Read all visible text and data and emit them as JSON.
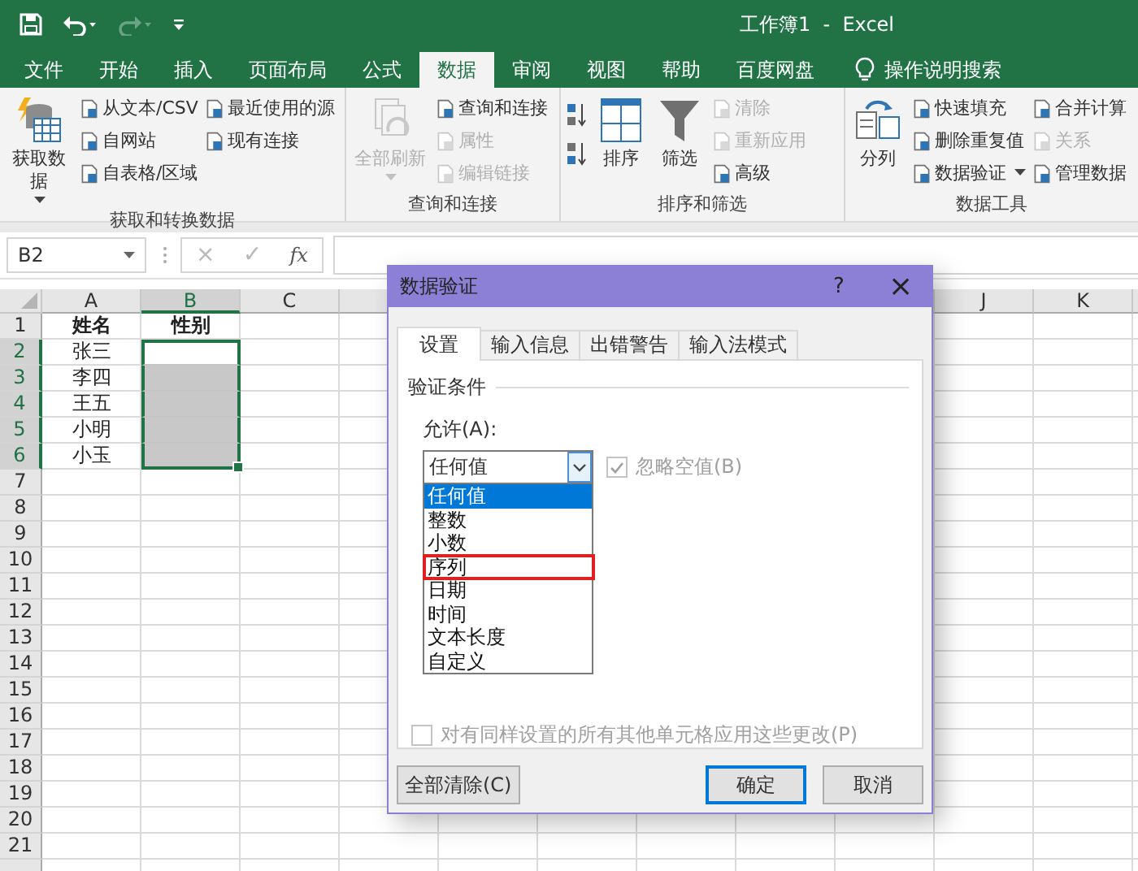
{
  "window": {
    "title": "工作簿1  -  Excel"
  },
  "tabs": [
    {
      "label": "文件",
      "selected": false
    },
    {
      "label": "开始",
      "selected": false
    },
    {
      "label": "插入",
      "selected": false
    },
    {
      "label": "页面布局",
      "selected": false
    },
    {
      "label": "公式",
      "selected": false
    },
    {
      "label": "数据",
      "selected": true
    },
    {
      "label": "审阅",
      "selected": false
    },
    {
      "label": "视图",
      "selected": false
    },
    {
      "label": "帮助",
      "selected": false
    },
    {
      "label": "百度网盘",
      "selected": false
    }
  ],
  "tell_me": "操作说明搜索",
  "ribbon": [
    {
      "label": "获取和转换数据",
      "columns": [
        {
          "kind": "large",
          "label": "获取数据",
          "dropdown": true,
          "disabled": false
        },
        {
          "kind": "stack",
          "items": [
            {
              "label": "从文本/CSV",
              "disabled": false,
              "dropdown": false
            },
            {
              "label": "自网站",
              "disabled": false,
              "dropdown": false
            },
            {
              "label": "自表格/区域",
              "disabled": false,
              "dropdown": false
            }
          ]
        },
        {
          "kind": "stack",
          "items": [
            {
              "label": "最近使用的源",
              "disabled": false,
              "dropdown": false
            },
            {
              "label": "现有连接",
              "disabled": false,
              "dropdown": false
            }
          ]
        }
      ]
    },
    {
      "label": "查询和连接",
      "columns": [
        {
          "kind": "large",
          "label": "全部刷新",
          "dropdown": true,
          "disabled": true
        },
        {
          "kind": "stack",
          "items": [
            {
              "label": "查询和连接",
              "disabled": false,
              "dropdown": false
            },
            {
              "label": "属性",
              "disabled": true,
              "dropdown": false
            },
            {
              "label": "编辑链接",
              "disabled": true,
              "dropdown": false
            }
          ]
        }
      ]
    },
    {
      "label": "排序和筛选",
      "columns": [
        {
          "kind": "sort_icons"
        },
        {
          "kind": "large",
          "label": "排序",
          "dropdown": false,
          "disabled": false
        },
        {
          "kind": "large",
          "label": "筛选",
          "dropdown": false,
          "disabled": false
        },
        {
          "kind": "stack",
          "items": [
            {
              "label": "清除",
              "disabled": true,
              "dropdown": false
            },
            {
              "label": "重新应用",
              "disabled": true,
              "dropdown": false
            },
            {
              "label": "高级",
              "disabled": false,
              "dropdown": false
            }
          ]
        }
      ]
    },
    {
      "label": "数据工具",
      "columns": [
        {
          "kind": "large",
          "label": "分列",
          "dropdown": false,
          "disabled": false
        },
        {
          "kind": "stack",
          "items": [
            {
              "label": "快速填充",
              "disabled": false,
              "dropdown": false
            },
            {
              "label": "删除重复值",
              "disabled": false,
              "dropdown": false
            },
            {
              "label": "数据验证",
              "disabled": false,
              "dropdown": true
            }
          ]
        },
        {
          "kind": "stack",
          "items": [
            {
              "label": "合并计算",
              "disabled": false,
              "dropdown": false
            },
            {
              "label": "关系",
              "disabled": true,
              "dropdown": false
            },
            {
              "label": "管理数据",
              "disabled": false,
              "dropdown": false
            }
          ]
        }
      ]
    }
  ],
  "formula_bar": {
    "name_box": "B2",
    "cancel": "×",
    "enter": "✓",
    "function": "fx"
  },
  "columns": [
    {
      "label": "A",
      "selected": false
    },
    {
      "label": "B",
      "selected": true
    },
    {
      "label": "C",
      "selected": false
    },
    {
      "label": "J",
      "selected": false
    },
    {
      "label": "K",
      "selected": false
    }
  ],
  "rows": [
    {
      "number": "1",
      "selected": false,
      "cells": [
        {
          "text": "姓名",
          "bold": true
        },
        {
          "text": "性别",
          "bold": true
        }
      ]
    },
    {
      "number": "2",
      "selected": true,
      "cells": [
        {
          "text": "张三",
          "bold": false
        }
      ]
    },
    {
      "number": "3",
      "selected": true,
      "cells": [
        {
          "text": "李四",
          "bold": false
        }
      ]
    },
    {
      "number": "4",
      "selected": true,
      "cells": [
        {
          "text": "王五",
          "bold": false
        }
      ]
    },
    {
      "number": "5",
      "selected": true,
      "cells": [
        {
          "text": "小明",
          "bold": false
        }
      ]
    },
    {
      "number": "6",
      "selected": true,
      "cells": [
        {
          "text": "小玉",
          "bold": false
        }
      ]
    },
    {
      "number": "7",
      "selected": false
    },
    {
      "number": "8",
      "selected": false
    },
    {
      "number": "9",
      "selected": false
    },
    {
      "number": "10",
      "selected": false
    },
    {
      "number": "11",
      "selected": false
    },
    {
      "number": "12",
      "selected": false
    },
    {
      "number": "13",
      "selected": false
    },
    {
      "number": "14",
      "selected": false
    },
    {
      "number": "15",
      "selected": false
    },
    {
      "number": "16",
      "selected": false
    },
    {
      "number": "17",
      "selected": false
    },
    {
      "number": "18",
      "selected": false
    },
    {
      "number": "19",
      "selected": false
    },
    {
      "number": "20",
      "selected": false
    },
    {
      "number": "21",
      "selected": false
    }
  ],
  "dialog": {
    "title": "数据验证",
    "help": "?",
    "close": "×",
    "tabs": [
      {
        "label": "设置",
        "selected": true
      },
      {
        "label": "输入信息",
        "selected": false
      },
      {
        "label": "出错警告",
        "selected": false
      },
      {
        "label": "输入法模式",
        "selected": false
      }
    ],
    "section": "验证条件",
    "allow_label": "允许(A):",
    "allow_value": "任何值",
    "ignore_blank": {
      "label": "忽略空值(B)",
      "checked": true,
      "disabled": true
    },
    "options": [
      {
        "label": "任何值",
        "selected": true,
        "highlighted": false
      },
      {
        "label": "整数",
        "selected": false,
        "highlighted": false
      },
      {
        "label": "小数",
        "selected": false,
        "highlighted": false
      },
      {
        "label": "序列",
        "selected": false,
        "highlighted": true
      },
      {
        "label": "日期",
        "selected": false,
        "highlighted": false
      },
      {
        "label": "时间",
        "selected": false,
        "highlighted": false
      },
      {
        "label": "文本长度",
        "selected": false,
        "highlighted": false
      },
      {
        "label": "自定义",
        "selected": false,
        "highlighted": false
      }
    ],
    "apply_all": {
      "label": "对有同样设置的所有其他单元格应用这些更改(P)",
      "checked": false,
      "disabled": true
    },
    "buttons": [
      {
        "label": "全部清除(C)",
        "kind": "secondary"
      },
      {
        "label": "确定",
        "kind": "default"
      },
      {
        "label": "取消",
        "kind": "secondary"
      }
    ]
  }
}
